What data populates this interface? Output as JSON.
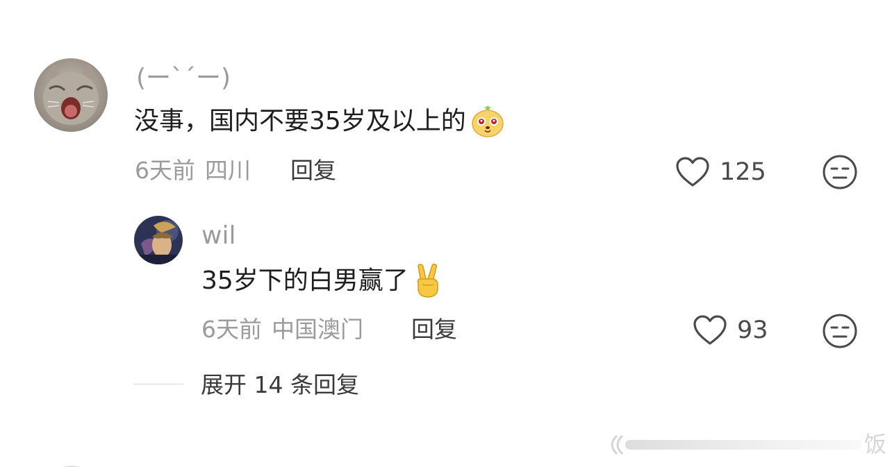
{
  "comment": {
    "username": "(ー`´ー)",
    "text": "没事，国内不要35岁及以上的",
    "emoji_icon": "dog-face-emoji",
    "time": "6天前",
    "location": "四川",
    "reply_label": "回复",
    "like_count": "125",
    "reply": {
      "username": "wil",
      "text": "35岁下的白男赢了",
      "emoji_icon": "victory-hand-emoji",
      "time": "6天前",
      "location": "中国澳门",
      "reply_label": "回复",
      "like_count": "93"
    }
  },
  "expand_label": "展开 14 条回复",
  "watermark_text": "饭",
  "colors": {
    "text_primary": "#1e1e1e",
    "text_secondary": "#9b9b9b",
    "action_text": "#3a3a3a",
    "icon_gray": "#4a4a4a"
  }
}
